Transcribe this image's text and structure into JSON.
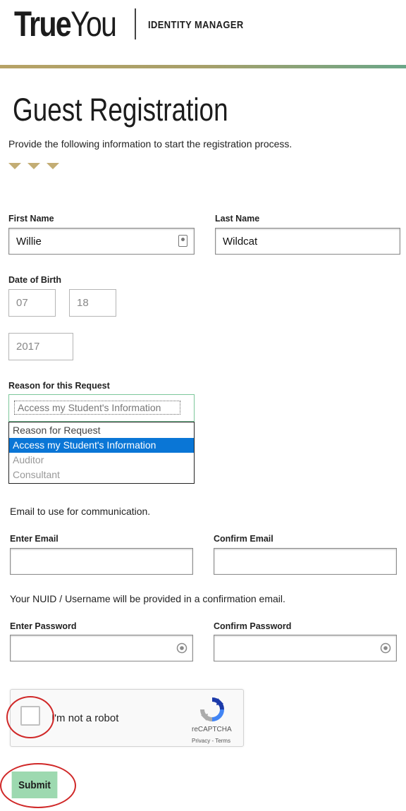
{
  "header": {
    "brand_true": "True",
    "brand_you": "You",
    "subtitle": "IDENTITY MANAGER"
  },
  "page": {
    "title": "Guest Registration",
    "intro": "Provide the following information to start the registration process."
  },
  "form": {
    "first_name": {
      "label": "First Name",
      "value": "Willie"
    },
    "last_name": {
      "label": "Last Name",
      "value": "Wildcat"
    },
    "dob": {
      "label": "Date of Birth",
      "month": "07",
      "day": "18",
      "year": "2017"
    },
    "reason": {
      "label": "Reason for this Request",
      "selected": "Access my Student's Information",
      "options": [
        "Reason for Request",
        "Access my Student's Information",
        "Auditor",
        "Consultant"
      ]
    },
    "email_note": "Email to use for communication.",
    "email": {
      "label": "Enter Email",
      "value": ""
    },
    "confirm_email": {
      "label": "Confirm Email",
      "value": ""
    },
    "nuid_note": "Your NUID / Username will be provided in a confirmation email.",
    "password": {
      "label": "Enter Password",
      "value": ""
    },
    "confirm_password": {
      "label": "Confirm Password",
      "value": ""
    }
  },
  "captcha": {
    "label": "I'm not a robot",
    "brand": "reCAPTCHA",
    "links": "Privacy - Terms"
  },
  "submit_label": "Submit",
  "colors": {
    "accent_gold": "#c3ad74",
    "submit_green": "#9dd9b0",
    "select_blue": "#0a76d6",
    "highlight_red": "#d02828"
  }
}
